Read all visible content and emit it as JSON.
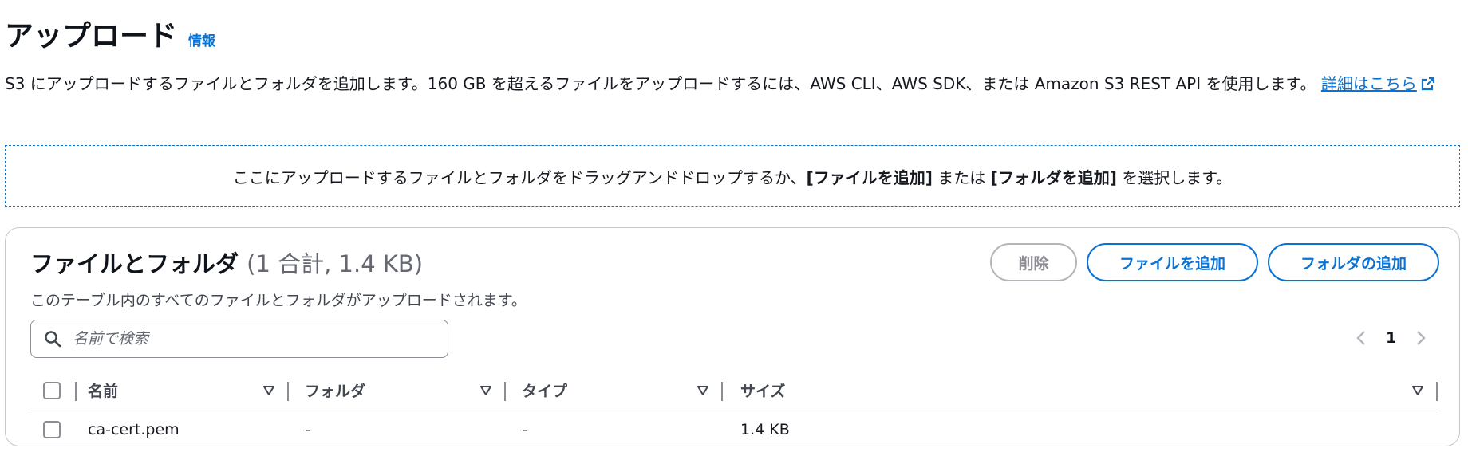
{
  "header": {
    "title": "アップロード",
    "info_link": "情報"
  },
  "description": {
    "text": "S3 にアップロードするファイルとフォルダを追加します。160 GB を超えるファイルをアップロードするには、AWS CLI、AWS SDK、または Amazon S3 REST API を使用します。",
    "link_label": "詳細はこちら"
  },
  "dropzone": {
    "prefix": "ここにアップロードするファイルとフォルダをドラッグアンドドロップするか、",
    "add_files": "[ファイルを追加]",
    "middle": " または ",
    "add_folder": "[フォルダを追加]",
    "suffix": " を選択します。"
  },
  "panel": {
    "title": "ファイルとフォルダ",
    "count": "(1 合計, 1.4 KB)",
    "subtitle": "このテーブル内のすべてのファイルとフォルダがアップロードされます。",
    "buttons": {
      "delete": "削除",
      "add_files": "ファイルを追加",
      "add_folder": "フォルダの追加"
    },
    "search": {
      "placeholder": "名前で検索",
      "value": ""
    },
    "pagination": {
      "current_page": "1"
    }
  },
  "table": {
    "columns": [
      "名前",
      "フォルダ",
      "タイプ",
      "サイズ"
    ],
    "rows": [
      {
        "name": "ca-cert.pem",
        "folder": "-",
        "type": "-",
        "size": "1.4 KB"
      }
    ]
  },
  "colors": {
    "link": "#0972d3",
    "text": "#16191f",
    "muted": "#656871",
    "border": "#c6c6cd",
    "disabled": "#8c8c94"
  },
  "icons": {
    "external_link": "external-link-icon",
    "search": "search-icon",
    "sort": "caret-down-icon",
    "prev": "chevron-left-icon",
    "next": "chevron-right-icon"
  }
}
